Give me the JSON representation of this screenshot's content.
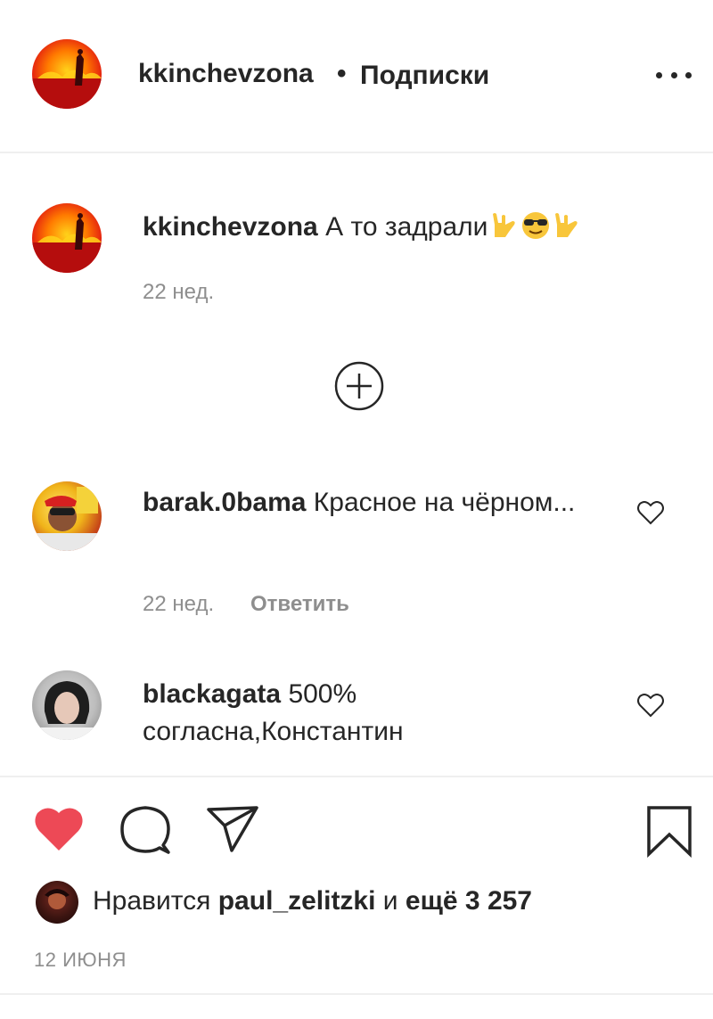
{
  "header": {
    "username": "kkinchevzona",
    "separator": "•",
    "follow_status": "Подписки",
    "more_icon": "more-horizontal-icon"
  },
  "caption": {
    "username": "kkinchevzona",
    "text": "А то задрали",
    "emojis": [
      "sign-of-horns",
      "smiling-face-with-sunglasses",
      "sign-of-horns"
    ],
    "time": "22 нед."
  },
  "load_more_icon": "plus-circle-icon",
  "comments": [
    {
      "username": "barak.0bama",
      "text": "Красное на чёрном...",
      "time": "22 нед.",
      "reply_label": "Ответить"
    },
    {
      "username": "blackagata",
      "text": "500% согласна,Константин"
    }
  ],
  "actions": {
    "like_icon": "heart-filled-icon",
    "comment_icon": "comment-icon",
    "share_icon": "paper-plane-icon",
    "save_icon": "bookmark-icon",
    "liked": true,
    "like_color": "#ed4956"
  },
  "likes": {
    "prefix": "Нравится",
    "user": "paul_zelitzki",
    "middle": "и",
    "count": "ещё 3 257"
  },
  "date": "12 ИЮНЯ"
}
